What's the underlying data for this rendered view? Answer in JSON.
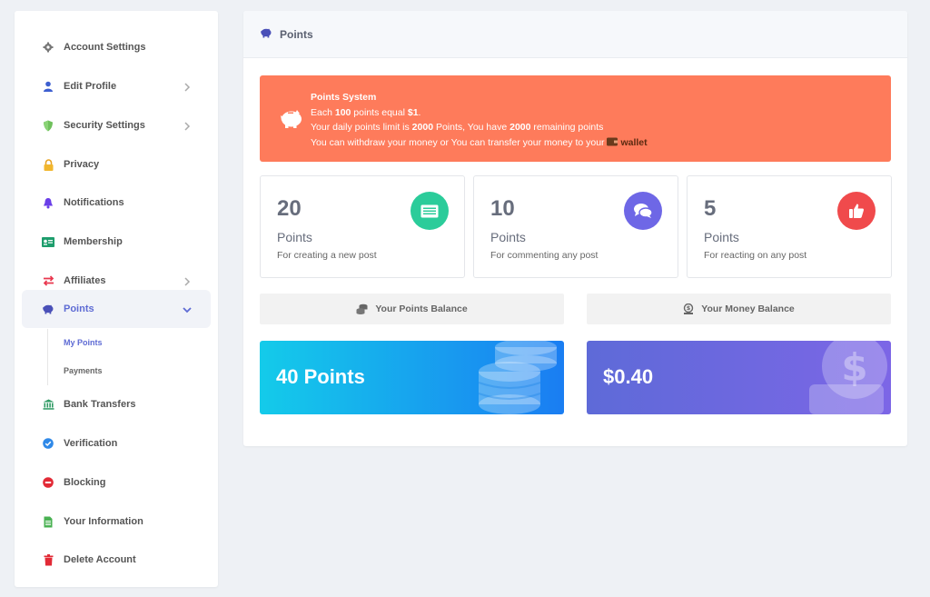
{
  "sidebar": {
    "items": [
      {
        "label": "Account Settings",
        "icon": "gear-icon"
      },
      {
        "label": "Edit Profile",
        "icon": "user-icon"
      },
      {
        "label": "Security Settings",
        "icon": "shield-icon"
      },
      {
        "label": "Privacy",
        "icon": "lock-icon"
      },
      {
        "label": "Notifications",
        "icon": "bell-icon"
      },
      {
        "label": "Membership",
        "icon": "id-card-icon"
      },
      {
        "label": "Affiliates",
        "icon": "exchange-icon"
      },
      {
        "label": "Points",
        "icon": "piggy-bank-icon"
      },
      {
        "label": "Bank Transfers",
        "icon": "bank-icon"
      },
      {
        "label": "Verification",
        "icon": "check-circle-icon"
      },
      {
        "label": "Blocking",
        "icon": "block-icon"
      },
      {
        "label": "Your Information",
        "icon": "document-icon"
      },
      {
        "label": "Delete Account",
        "icon": "trash-icon"
      }
    ],
    "sub_items": [
      {
        "label": "My Points"
      },
      {
        "label": "Payments"
      }
    ]
  },
  "main": {
    "title": "Points",
    "alert": {
      "title": "Points System",
      "line1_a": "Each ",
      "line1_b": "100",
      "line1_c": " points equal ",
      "line1_d": "$1",
      "line1_e": ".",
      "line2_a": "Your daily points limit is ",
      "line2_b": "2000",
      "line2_c": " Points, You have ",
      "line2_d": "2000",
      "line2_e": " remaining points",
      "line3_a": "You can withdraw your money or You can transfer your money to your ",
      "line3_link": "wallet"
    },
    "stats": [
      {
        "value": "20",
        "unit": "Points",
        "desc": "For creating a new post",
        "icon": "newspaper-icon"
      },
      {
        "value": "10",
        "unit": "Points",
        "desc": "For commenting any post",
        "icon": "comments-icon"
      },
      {
        "value": "5",
        "unit": "Points",
        "desc": "For reacting on any post",
        "icon": "thumbs-up-icon"
      }
    ],
    "balances": {
      "points_label": "Your Points Balance",
      "money_label": "Your Money Balance",
      "points_value": "40 Points",
      "money_value": "$0.40"
    }
  },
  "colors": {
    "accent": "#5e6bd4",
    "alert_bg": "#fe7b5b",
    "green": "#2bcc9a",
    "purple": "#6e67e6",
    "red": "#f04a4c",
    "points_gradient": [
      "#14cbea",
      "#1a7df2"
    ],
    "money_gradient": [
      "#5e6ad8",
      "#7c66e6"
    ]
  }
}
